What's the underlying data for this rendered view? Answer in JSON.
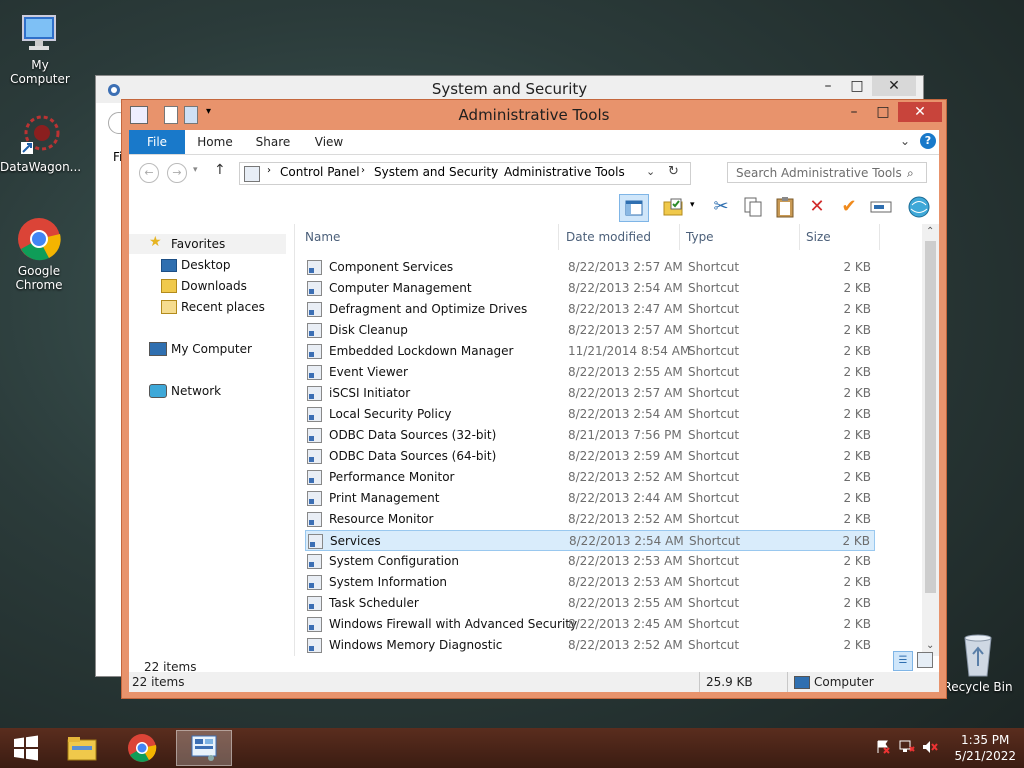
{
  "desktop": {
    "icons": [
      {
        "label": "My Computer"
      },
      {
        "label": "DataWagon..."
      },
      {
        "label": "Google Chrome"
      },
      {
        "label": "Recycle Bin"
      }
    ]
  },
  "back_window": {
    "title": "System and Security",
    "peek_text": "Fi"
  },
  "window": {
    "title": "Administrative Tools",
    "ribbon_tabs": [
      "File",
      "Home",
      "Share",
      "View"
    ],
    "breadcrumb": [
      "Control Panel",
      "System and Security",
      "Administrative Tools"
    ],
    "search_placeholder": "Search Administrative Tools",
    "nav": {
      "favorites": "Favorites",
      "desktop": "Desktop",
      "downloads": "Downloads",
      "recent": "Recent places",
      "computer": "My Computer",
      "network": "Network"
    },
    "columns": [
      "Name",
      "Date modified",
      "Type",
      "Size"
    ],
    "files": [
      {
        "name": "Component Services",
        "date": "8/22/2013 2:57 AM",
        "type": "Shortcut",
        "size": "2 KB"
      },
      {
        "name": "Computer Management",
        "date": "8/22/2013 2:54 AM",
        "type": "Shortcut",
        "size": "2 KB"
      },
      {
        "name": "Defragment and Optimize Drives",
        "date": "8/22/2013 2:47 AM",
        "type": "Shortcut",
        "size": "2 KB"
      },
      {
        "name": "Disk Cleanup",
        "date": "8/22/2013 2:57 AM",
        "type": "Shortcut",
        "size": "2 KB"
      },
      {
        "name": "Embedded Lockdown Manager",
        "date": "11/21/2014 8:54 AM",
        "type": "Shortcut",
        "size": "2 KB"
      },
      {
        "name": "Event Viewer",
        "date": "8/22/2013 2:55 AM",
        "type": "Shortcut",
        "size": "2 KB"
      },
      {
        "name": "iSCSI Initiator",
        "date": "8/22/2013 2:57 AM",
        "type": "Shortcut",
        "size": "2 KB"
      },
      {
        "name": "Local Security Policy",
        "date": "8/22/2013 2:54 AM",
        "type": "Shortcut",
        "size": "2 KB"
      },
      {
        "name": "ODBC Data Sources (32-bit)",
        "date": "8/21/2013 7:56 PM",
        "type": "Shortcut",
        "size": "2 KB"
      },
      {
        "name": "ODBC Data Sources (64-bit)",
        "date": "8/22/2013 2:59 AM",
        "type": "Shortcut",
        "size": "2 KB"
      },
      {
        "name": "Performance Monitor",
        "date": "8/22/2013 2:52 AM",
        "type": "Shortcut",
        "size": "2 KB"
      },
      {
        "name": "Print Management",
        "date": "8/22/2013 2:44 AM",
        "type": "Shortcut",
        "size": "2 KB"
      },
      {
        "name": "Resource Monitor",
        "date": "8/22/2013 2:52 AM",
        "type": "Shortcut",
        "size": "2 KB"
      },
      {
        "name": "Services",
        "date": "8/22/2013 2:54 AM",
        "type": "Shortcut",
        "size": "2 KB",
        "selected": true
      },
      {
        "name": "System Configuration",
        "date": "8/22/2013 2:53 AM",
        "type": "Shortcut",
        "size": "2 KB"
      },
      {
        "name": "System Information",
        "date": "8/22/2013 2:53 AM",
        "type": "Shortcut",
        "size": "2 KB"
      },
      {
        "name": "Task Scheduler",
        "date": "8/22/2013 2:55 AM",
        "type": "Shortcut",
        "size": "2 KB"
      },
      {
        "name": "Windows Firewall with Advanced Security",
        "date": "8/22/2013 2:45 AM",
        "type": "Shortcut",
        "size": "2 KB"
      },
      {
        "name": "Windows Memory Diagnostic",
        "date": "8/22/2013 2:52 AM",
        "type": "Shortcut",
        "size": "2 KB"
      }
    ],
    "items_count": "22 items",
    "status": {
      "items": "22 items",
      "size": "25.9 KB",
      "location": "Computer"
    }
  },
  "taskbar": {
    "time": "1:35 PM",
    "date": "5/21/2022"
  },
  "colors": {
    "accent": "#1979ca",
    "window_frame": "#e8936c",
    "selection": "#d9ecfb"
  }
}
